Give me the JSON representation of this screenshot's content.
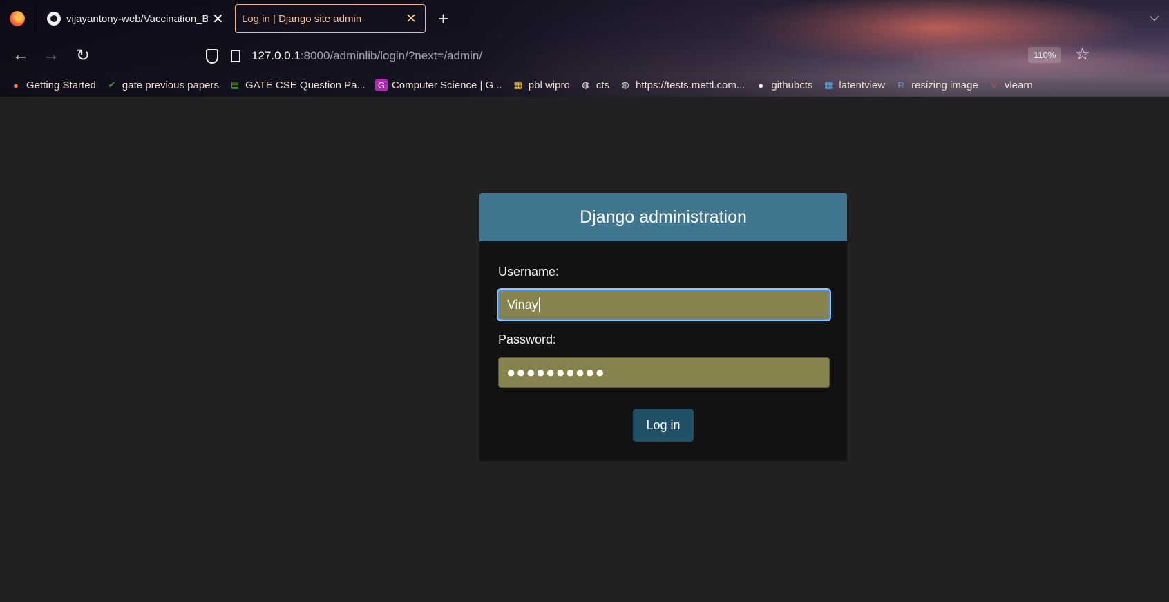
{
  "browser": {
    "tabs": [
      {
        "title": "vijayantony-web/Vaccination_B"
      },
      {
        "title": "Log in | Django site admin"
      }
    ],
    "url": {
      "host": "127.0.0.1",
      "rest": ":8000/adminlib/login/?next=/admin/"
    },
    "zoom": "110%",
    "bookmarks": [
      {
        "label": "Getting Started",
        "icon": "firefox-icon",
        "color": "#ff7139"
      },
      {
        "label": "gate previous papers",
        "icon": "check-icon",
        "color": "#2e9e4a"
      },
      {
        "label": "GATE CSE Question Pa...",
        "icon": "books-icon",
        "color": "#6a9e2e"
      },
      {
        "label": "Computer Science | G...",
        "icon": "g-icon",
        "color": "#b02ab0"
      },
      {
        "label": "pbl wipro",
        "icon": "pbl-icon",
        "color": "#f4d35e"
      },
      {
        "label": "cts",
        "icon": "globe-icon",
        "color": "#eee"
      },
      {
        "label": "https://tests.mettl.com...",
        "icon": "globe-icon",
        "color": "#eee"
      },
      {
        "label": "githubcts",
        "icon": "github-icon",
        "color": "#eee"
      },
      {
        "label": "latentview",
        "icon": "latentview-icon",
        "color": "#6aa7d8"
      },
      {
        "label": "resizing image",
        "icon": "rp-icon",
        "color": "#4f9fd9"
      },
      {
        "label": "vlearn",
        "icon": "vl-icon",
        "color": "#d9434f"
      }
    ]
  },
  "login": {
    "header": "Django administration",
    "username_label": "Username:",
    "username_value": "Vinay",
    "password_label": "Password:",
    "password_mask": "●●●●●●●●●●",
    "submit_label": "Log in"
  }
}
